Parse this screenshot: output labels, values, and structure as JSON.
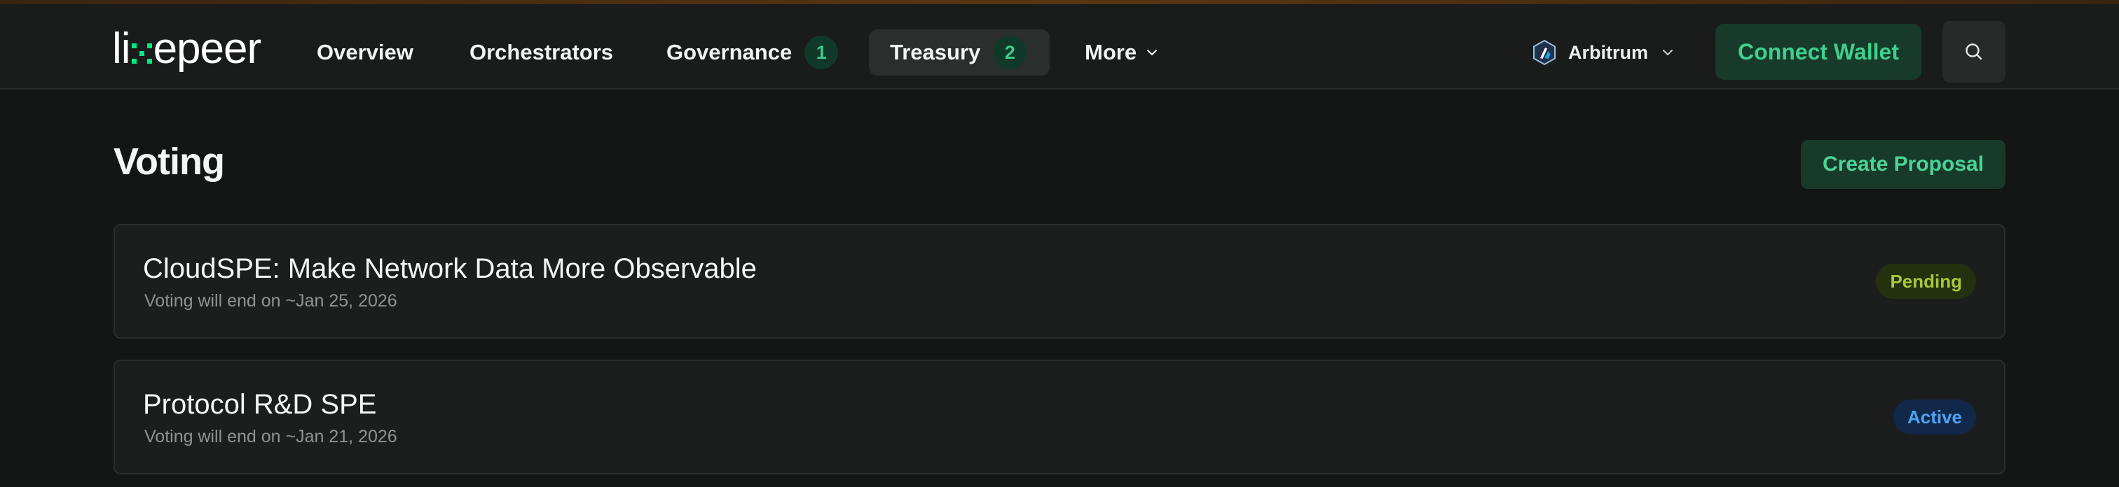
{
  "brand": {
    "name_left": "li",
    "name_right": "epeer"
  },
  "nav": {
    "items": [
      {
        "label": "Overview"
      },
      {
        "label": "Orchestrators"
      },
      {
        "label": "Governance",
        "badge": "1"
      },
      {
        "label": "Treasury",
        "badge": "2"
      },
      {
        "label": "More"
      }
    ]
  },
  "network": {
    "label": "Arbitrum"
  },
  "header_actions": {
    "connect_label": "Connect Wallet"
  },
  "page": {
    "title": "Voting",
    "create_label": "Create Proposal"
  },
  "proposals": [
    {
      "title": "CloudSPE: Make Network Data More Observable",
      "subtitle": "Voting will end on ~Jan 25, 2026",
      "status": "Pending"
    },
    {
      "title": "Protocol R&D SPE",
      "subtitle": "Voting will end on ~Jan 21, 2026",
      "status": "Active"
    }
  ],
  "colors": {
    "accent": "#3fcf8e",
    "pending": "#a6c83a",
    "active": "#4da3f3",
    "background": "#131614"
  },
  "icons": [
    "arbitrum-icon",
    "chevron-down-icon",
    "search-icon"
  ]
}
